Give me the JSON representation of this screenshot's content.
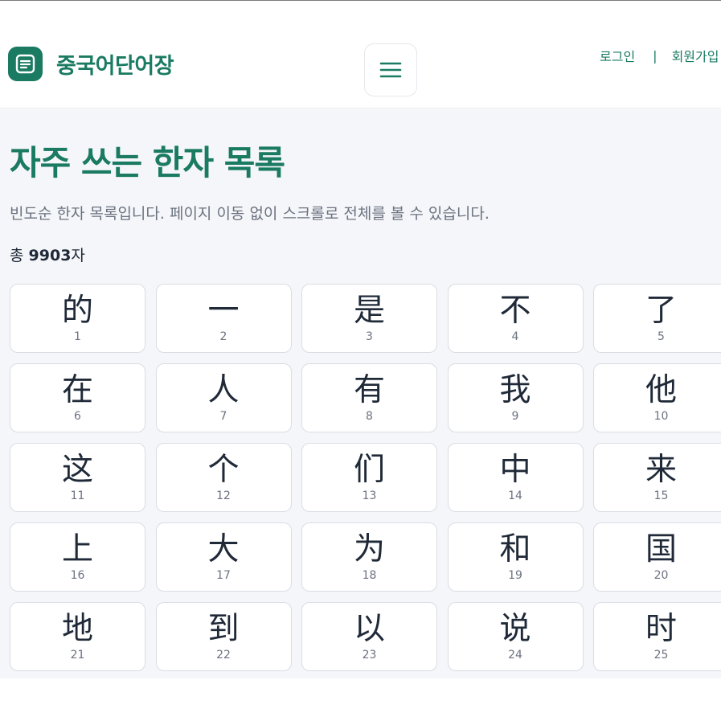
{
  "header": {
    "site_name": "중국어단어장",
    "logo_icon": "document-lines-icon",
    "menu_icon": "hamburger-menu-icon",
    "login_label": "로그인",
    "separator": "|",
    "signup_label": "회원가입"
  },
  "main": {
    "title": "자주 쓰는 한자 목록",
    "description": "빈도순 한자 목록입니다. 페이지 이동 없이 스크롤로 전체를 볼 수 있습니다.",
    "count_prefix": "총 ",
    "count_value": "9903",
    "count_suffix": "자",
    "characters": [
      {
        "char": "的",
        "rank": "1"
      },
      {
        "char": "一",
        "rank": "2"
      },
      {
        "char": "是",
        "rank": "3"
      },
      {
        "char": "不",
        "rank": "4"
      },
      {
        "char": "了",
        "rank": "5"
      },
      {
        "char": "在",
        "rank": "6"
      },
      {
        "char": "人",
        "rank": "7"
      },
      {
        "char": "有",
        "rank": "8"
      },
      {
        "char": "我",
        "rank": "9"
      },
      {
        "char": "他",
        "rank": "10"
      },
      {
        "char": "这",
        "rank": "11"
      },
      {
        "char": "个",
        "rank": "12"
      },
      {
        "char": "们",
        "rank": "13"
      },
      {
        "char": "中",
        "rank": "14"
      },
      {
        "char": "来",
        "rank": "15"
      },
      {
        "char": "上",
        "rank": "16"
      },
      {
        "char": "大",
        "rank": "17"
      },
      {
        "char": "为",
        "rank": "18"
      },
      {
        "char": "和",
        "rank": "19"
      },
      {
        "char": "国",
        "rank": "20"
      },
      {
        "char": "地",
        "rank": "21"
      },
      {
        "char": "到",
        "rank": "22"
      },
      {
        "char": "以",
        "rank": "23"
      },
      {
        "char": "说",
        "rank": "24"
      },
      {
        "char": "时",
        "rank": "25"
      }
    ]
  },
  "colors": {
    "brand": "#1a7a62",
    "background": "#f5f6f9",
    "card_border": "#d9dde3"
  }
}
